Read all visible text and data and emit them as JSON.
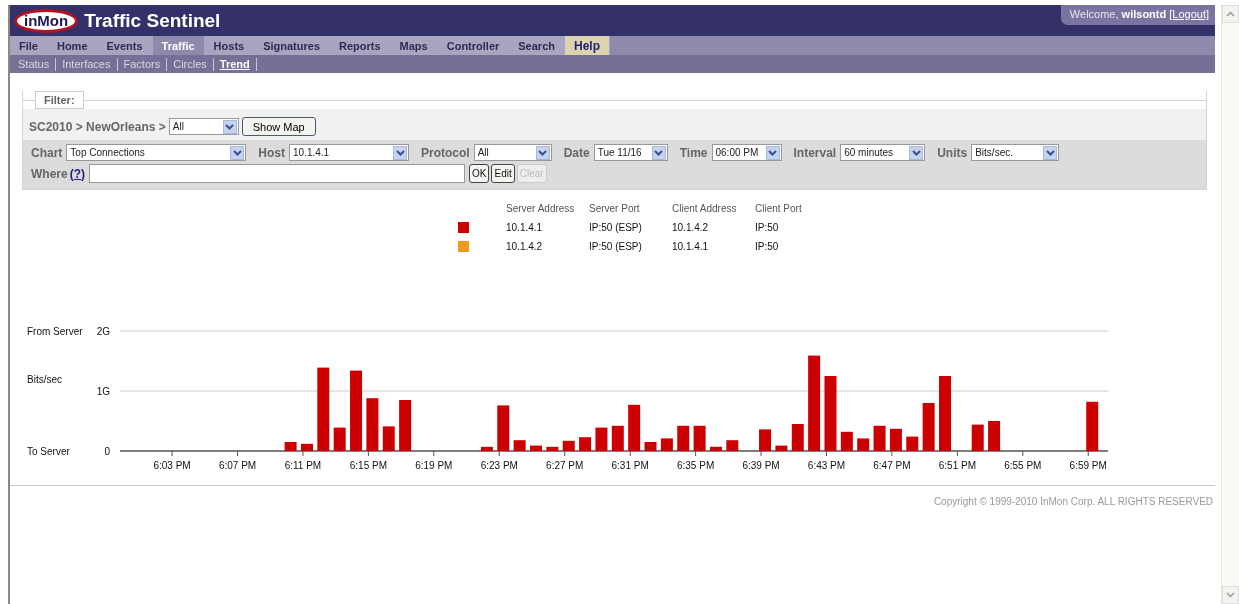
{
  "header": {
    "logo": "inMon",
    "title": "Traffic Sentinel",
    "greeting": "Welcome,",
    "user": "wilsontd",
    "logout": "[Logout]"
  },
  "menu": [
    {
      "label": "File",
      "selected": false,
      "kind": "normal"
    },
    {
      "label": "Home",
      "selected": false,
      "kind": "normal"
    },
    {
      "label": "Events",
      "selected": false,
      "kind": "normal"
    },
    {
      "label": "Traffic",
      "selected": true,
      "kind": "normal"
    },
    {
      "label": "Hosts",
      "selected": false,
      "kind": "normal"
    },
    {
      "label": "Signatures",
      "selected": false,
      "kind": "normal"
    },
    {
      "label": "Reports",
      "selected": false,
      "kind": "normal"
    },
    {
      "label": "Maps",
      "selected": false,
      "kind": "normal"
    },
    {
      "label": "Controller",
      "selected": false,
      "kind": "normal"
    },
    {
      "label": "Search",
      "selected": false,
      "kind": "normal"
    },
    {
      "label": "Help",
      "selected": false,
      "kind": "help"
    }
  ],
  "submenu": [
    {
      "label": "Status",
      "selected": false
    },
    {
      "label": "Interfaces",
      "selected": false
    },
    {
      "label": "Factors",
      "selected": false
    },
    {
      "label": "Circles",
      "selected": false
    },
    {
      "label": "Trend",
      "selected": true
    }
  ],
  "filter": {
    "legend": "Filter:",
    "path": "SC2010 > NewOrleans >",
    "site": "All",
    "show_map": "Show Map",
    "fields": [
      {
        "label": "Chart",
        "value": "Top Connections"
      },
      {
        "label": "Host",
        "value": "10.1.4.1"
      },
      {
        "label": "Protocol",
        "value": "All"
      },
      {
        "label": "Date",
        "value": "Tue 11/16"
      },
      {
        "label": "Time",
        "value": "06:00 PM"
      },
      {
        "label": "Interval",
        "value": "60 minutes"
      },
      {
        "label": "Units",
        "value": "Bits/sec."
      }
    ],
    "where": {
      "label": "Where",
      "help": "(?)"
    },
    "buttons": [
      {
        "label": "OK",
        "disabled": false
      },
      {
        "label": "Edit",
        "disabled": false
      },
      {
        "label": "Clear",
        "disabled": true
      }
    ]
  },
  "legend": {
    "columns": [
      "Server Address",
      "Server Port",
      "Client Address",
      "Client Port"
    ],
    "rows": [
      {
        "color": "#cc0000",
        "cells": [
          "10.1.4.1",
          "IP:50 (ESP)",
          "10.1.4.2",
          "IP:50"
        ]
      },
      {
        "color": "#f09a1a",
        "cells": [
          "10.1.4.2",
          "IP:50 (ESP)",
          "10.1.4.1",
          "IP:50"
        ]
      }
    ]
  },
  "chart": {
    "top_label": "From Server",
    "bottom_label": "To Server",
    "chart_data": {
      "type": "bar",
      "ylabel": "Bits/sec",
      "categories": [
        null,
        null,
        null,
        "6:03 PM",
        null,
        null,
        null,
        "6:07 PM",
        null,
        null,
        null,
        "6:11 PM",
        null,
        null,
        null,
        "6:15 PM",
        null,
        null,
        null,
        "6:19 PM",
        null,
        null,
        null,
        "6:23 PM",
        null,
        null,
        null,
        "6:27 PM",
        null,
        null,
        null,
        "6:31 PM",
        null,
        null,
        null,
        "6:35 PM",
        null,
        null,
        null,
        "6:39 PM",
        null,
        null,
        null,
        "6:43 PM",
        null,
        null,
        null,
        "6:47 PM",
        null,
        null,
        null,
        "6:51 PM",
        null,
        null,
        null,
        "6:55 PM",
        null,
        null,
        null,
        "6:59 PM"
      ],
      "series": [
        {
          "color": "#cc0000",
          "values": [
            0,
            0,
            0,
            0,
            0,
            0,
            0,
            0,
            0,
            0,
            0.15,
            0.12,
            1.39,
            0.39,
            1.34,
            0.88,
            0.41,
            0.85,
            0,
            0,
            0,
            0,
            0.07,
            0.76,
            0.18,
            0.09,
            0.07,
            0.17,
            0.23,
            0.39,
            0.42,
            0.77,
            0.15,
            0.21,
            0.42,
            0.42,
            0.07,
            0.18,
            0,
            0.36,
            0.09,
            0.45,
            1.59,
            1.25,
            0.32,
            0.21,
            0.42,
            0.37,
            0.24,
            0.8,
            1.25,
            0,
            0.44,
            0.5,
            0,
            0,
            0,
            0,
            0,
            0.82
          ]
        }
      ],
      "ylim": [
        0,
        2
      ],
      "yticks": [
        {
          "value": 0,
          "label": "0"
        },
        {
          "value": 1,
          "label": "1G"
        },
        {
          "value": 2,
          "label": "2G"
        }
      ]
    }
  },
  "footer": {
    "copyright": "Copyright © 1999-2010 InMon Corp. ALL RIGHTS RESERVED"
  }
}
